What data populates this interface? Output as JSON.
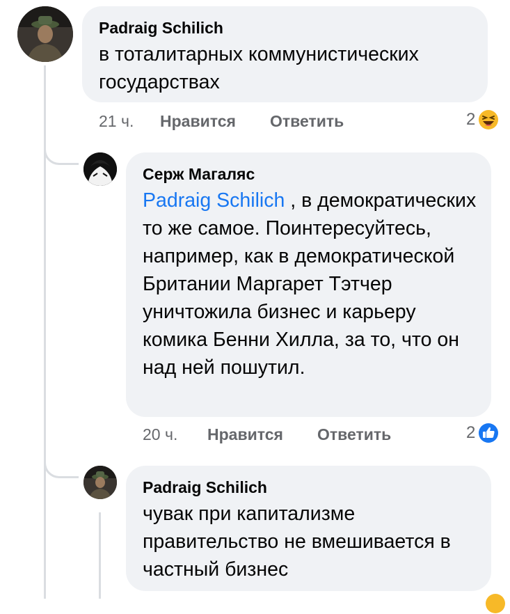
{
  "comments": [
    {
      "author": "Padraig Schilich",
      "text": "в тоталитарных коммунистических государствах",
      "time": "21 ч.",
      "like_label": "Нравится",
      "reply_label": "Ответить",
      "reaction_count": "2",
      "reaction_icon": "laughing-emoji-icon"
    },
    {
      "author": "Серж Магаляс",
      "mention": "Padraig Schilich",
      "text": " , в демократических то же самое. Поинтересуйтесь, например, как в демократической Британии Маргарет Тэтчер уничтожила бизнес и карьеру комика Бенни Хилла, за то, что он над ней пошутил.",
      "time": "20 ч.",
      "like_label": "Нравится",
      "reply_label": "Ответить",
      "reaction_count": "2",
      "reaction_icon": "like-thumb-icon"
    },
    {
      "author": "Padraig Schilich",
      "text": "чувак при капитализме правительство не вмешивается в частный бизнес"
    }
  ],
  "colors": {
    "bubble": "#f0f2f5",
    "meta": "#65676b",
    "mention": "#1877f2",
    "like": "#1877f2",
    "haha": "#f7b928"
  }
}
